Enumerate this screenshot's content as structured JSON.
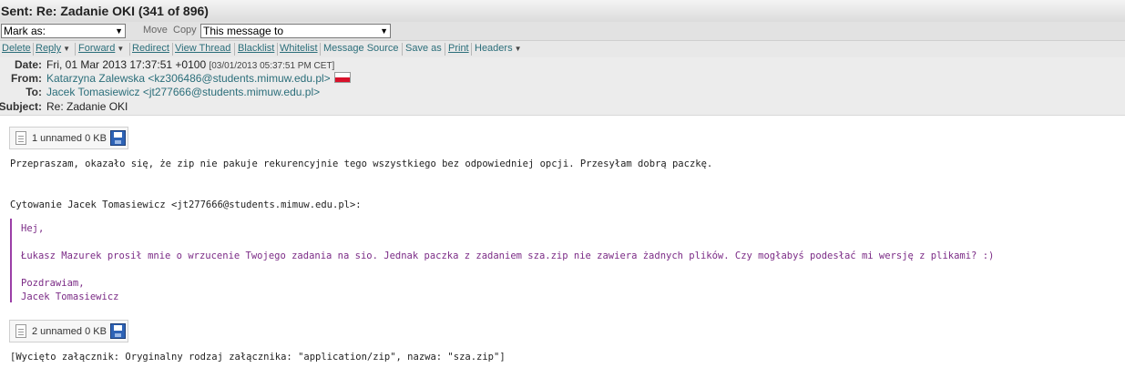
{
  "title": "Sent: Re: Zadanie OKI (341 of 896)",
  "actionbar": {
    "mark_as": "Mark as:",
    "move": "Move",
    "copy": "Copy",
    "target": "This message to"
  },
  "toolbar": {
    "delete": "Delete",
    "reply": "Reply",
    "forward": "Forward",
    "redirect": "Redirect",
    "view_thread": "View Thread",
    "blacklist": "Blacklist",
    "whitelist": "Whitelist",
    "message_source": "Message Source",
    "save_as": "Save as",
    "print": "Print",
    "headers": "Headers"
  },
  "headers": {
    "date_label": "Date:",
    "date_value": "Fri, 01 Mar 2013 17:37:51 +0100",
    "date_local": "[03/01/2013 05:37:51 PM CET]",
    "from_label": "From:",
    "from_value": "Katarzyna Zalewska <kz306486@students.mimuw.edu.pl>",
    "to_label": "To:",
    "to_value": "Jacek Tomasiewicz <jt277666@students.mimuw.edu.pl>",
    "subject_label": "Subject:",
    "subject_value": "Re: Zadanie OKI"
  },
  "attachments": [
    {
      "label": "1 unnamed 0 KB"
    },
    {
      "label": "2 unnamed 0 KB"
    }
  ],
  "body": {
    "line1": "Przepraszam, okazało się, że zip nie pakuje rekurencyjnie tego wszystkiego bez odpowiedniej opcji. Przesyłam dobrą paczkę.",
    "citation": "Cytowanie Jacek Tomasiewicz <jt277666@students.mimuw.edu.pl>:",
    "quote": {
      "greeting": "Hej,",
      "text": "Łukasz Mazurek prosił mnie o wrzucenie Twojego zadania na sio. Jednak paczka z zadaniem sza.zip nie zawiera żadnych plików. Czy mogłabyś podesłać mi wersję z plikami? :)",
      "sign1": "Pozdrawiam,",
      "sign2": "Jacek Tomasiewicz"
    },
    "removed": "[Wycięto załącznik: Oryginalny rodzaj załącznika: \"application/zip\", nazwa: \"sza.zip\"]"
  }
}
